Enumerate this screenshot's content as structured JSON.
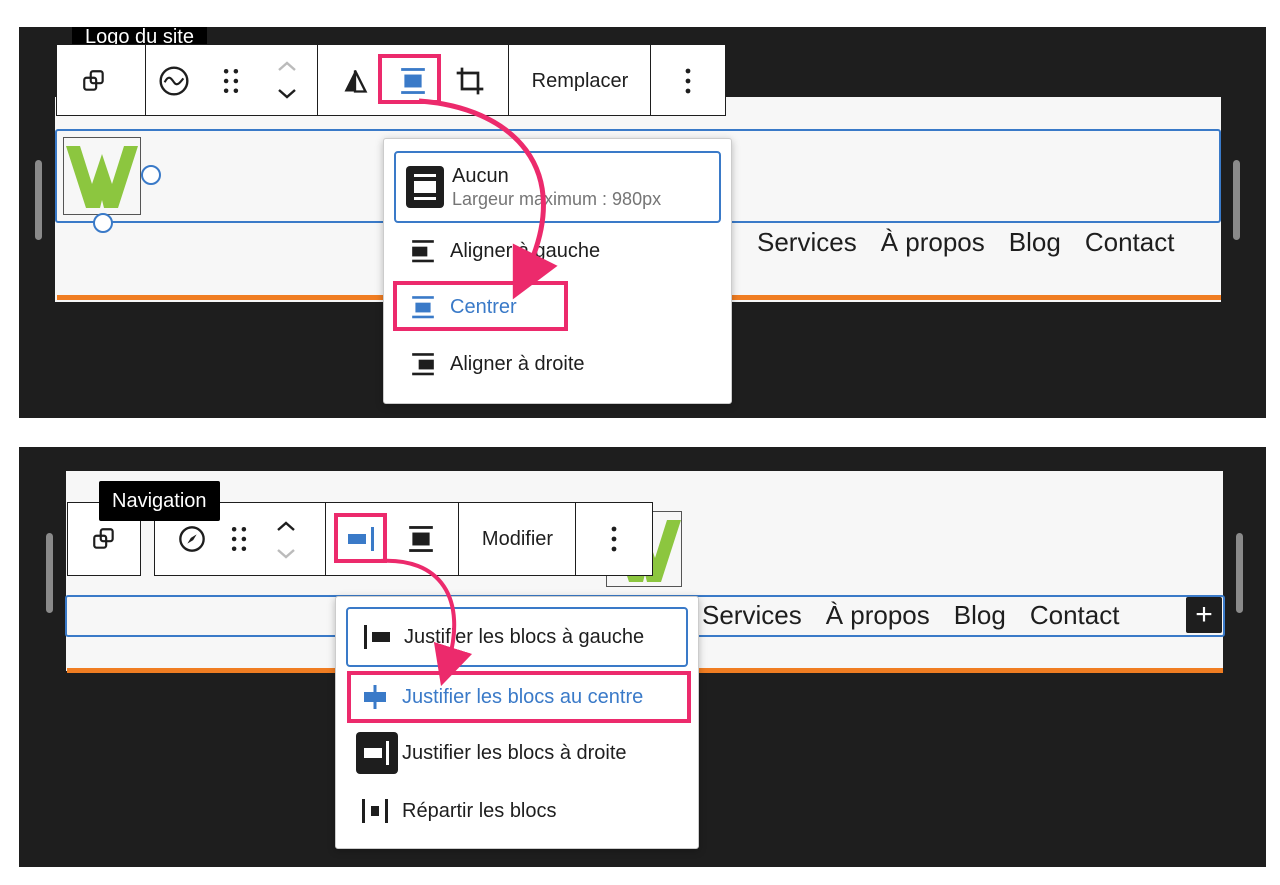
{
  "colors": {
    "accent": "#3a7ac8",
    "highlight": "#ec2a6c",
    "orange": "#f07d22",
    "logo_green": "#8cc63f",
    "dark": "#1e1e1e"
  },
  "panel1": {
    "tooltip": "Logo du site",
    "toolbar": {
      "replace_label": "Remplacer"
    },
    "nav_links": [
      "Services",
      "À propos",
      "Blog",
      "Contact"
    ],
    "dropdown": {
      "items": [
        {
          "label": "Aucun",
          "sublabel": "Largeur maximum : 980px",
          "icon": "align-none-icon"
        },
        {
          "label": "Aligner à gauche",
          "icon": "align-left-icon"
        },
        {
          "label": "Centrer",
          "icon": "align-center-icon"
        },
        {
          "label": "Aligner à droite",
          "icon": "align-right-icon"
        }
      ]
    }
  },
  "panel2": {
    "tooltip": "Navigation",
    "toolbar": {
      "edit_label": "Modifier"
    },
    "nav_links": [
      "Services",
      "À propos",
      "Blog",
      "Contact"
    ],
    "add_label": "+",
    "dropdown": {
      "items": [
        {
          "label": "Justifier les blocs à gauche",
          "icon": "justify-left-icon"
        },
        {
          "label": "Justifier les blocs au centre",
          "icon": "justify-center-icon"
        },
        {
          "label": "Justifier les blocs à droite",
          "icon": "justify-right-icon"
        },
        {
          "label": "Répartir les blocs",
          "icon": "justify-space-between-icon"
        }
      ]
    }
  }
}
